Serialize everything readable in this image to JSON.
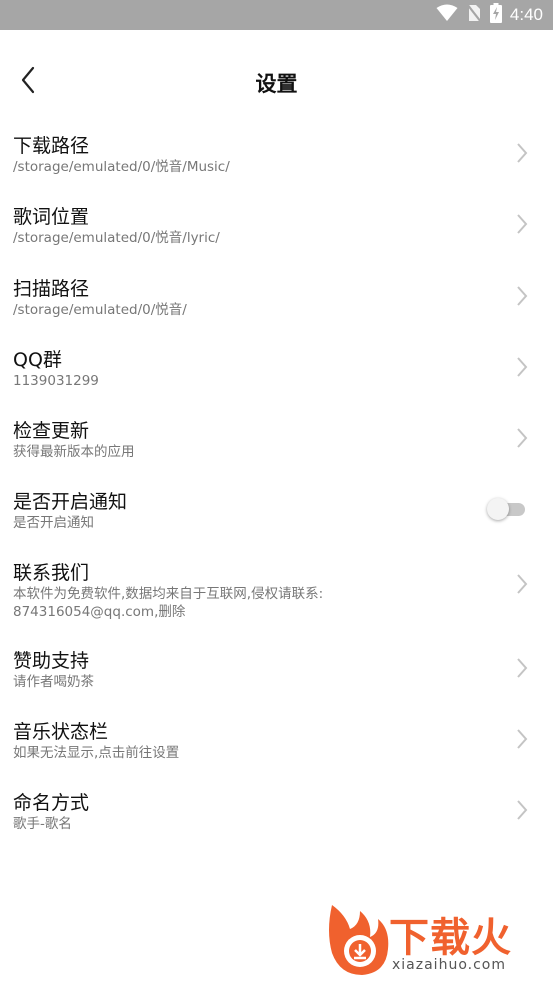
{
  "status_bar": {
    "time": "4:40",
    "icons": [
      "wifi-icon",
      "no-sim-icon",
      "battery-charging-icon"
    ]
  },
  "header": {
    "title": "设置",
    "back_icon": "chevron-left-icon"
  },
  "settings": [
    {
      "id": "download-path",
      "title": "下载路径",
      "subtitle": "/storage/emulated/0/悦音/Music/",
      "control": "chevron"
    },
    {
      "id": "lyric-location",
      "title": "歌词位置",
      "subtitle": "/storage/emulated/0/悦音/lyric/",
      "control": "chevron"
    },
    {
      "id": "scan-path",
      "title": "扫描路径",
      "subtitle": "/storage/emulated/0/悦音/",
      "control": "chevron"
    },
    {
      "id": "qq-group",
      "title": "QQ群",
      "subtitle": "1139031299",
      "control": "chevron"
    },
    {
      "id": "check-update",
      "title": "检查更新",
      "subtitle": "获得最新版本的应用",
      "control": "chevron"
    },
    {
      "id": "notification",
      "title": "是否开启通知",
      "subtitle": "是否开启通知",
      "control": "toggle",
      "toggle_on": false
    },
    {
      "id": "contact-us",
      "title": "联系我们",
      "subtitle": "本软件为免费软件,数据均来自于互联网,侵权请联系: 874316054@qq.com,删除",
      "control": "chevron"
    },
    {
      "id": "sponsor",
      "title": "赞助支持",
      "subtitle": "请作者喝奶茶",
      "control": "chevron"
    },
    {
      "id": "music-statusbar",
      "title": "音乐状态栏",
      "subtitle": "如果无法显示,点击前往设置",
      "control": "chevron"
    },
    {
      "id": "naming-method",
      "title": "命名方式",
      "subtitle": "歌手-歌名",
      "control": "chevron"
    }
  ],
  "watermark": {
    "text": "下载火",
    "url": "xiazaihuo.com"
  },
  "colors": {
    "status_bar": "#a6a6a6",
    "title_text": "#111111",
    "subtitle_text": "#777777",
    "chevron": "#c4c4c4",
    "toggle_track": "#c8c8c8",
    "toggle_thumb": "#f4f4f4",
    "watermark": "#f0612e"
  }
}
